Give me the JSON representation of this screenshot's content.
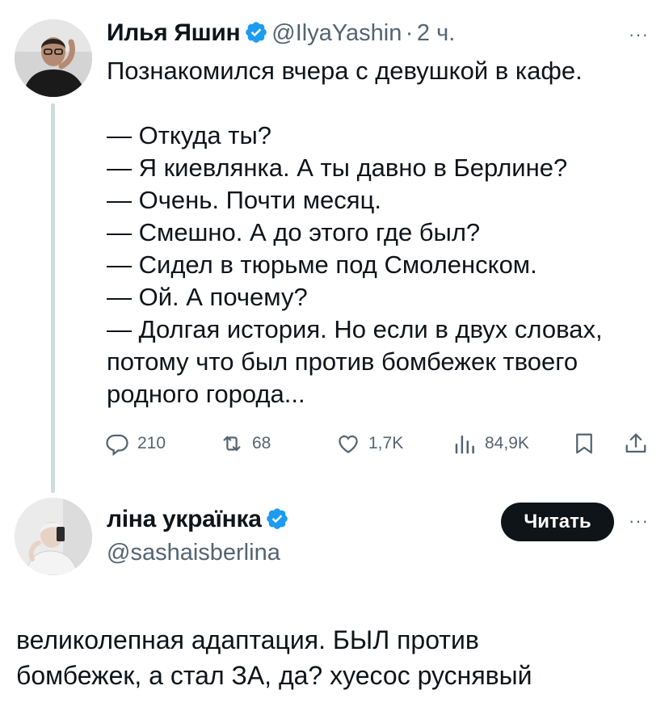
{
  "tweet": {
    "author_name": "Илья Яшин",
    "handle": "@IlyaYashin",
    "separator": "·",
    "time": "2 ч.",
    "more": "···",
    "lines": [
      "Познакомился вчера с девушкой в кафе.",
      "",
      "— Откуда ты?",
      "— Я киевлянка. А ты давно в Берлине?",
      "— Очень. Почти месяц.",
      "— Смешно. А до этого где был?",
      "— Сидел в тюрьме под Смоленском.",
      "— Ой. А почему?",
      "— Долгая история. Но если в двух словах,",
      "потому что был против бомбежек твоего",
      "родного города..."
    ],
    "stats": {
      "replies": "210",
      "reposts": "68",
      "likes": "1,7K",
      "views": "84,9K"
    }
  },
  "reply": {
    "author_name": "ліна українка",
    "handle": "@sashaisberlina",
    "follow_label": "Читать",
    "more": "···",
    "lines": [
      "великолепная адаптация. БЫЛ против",
      "бомбежек, а стал ЗА, да? хуесос руснявый"
    ]
  },
  "colors": {
    "verified": "#1d9bf0",
    "secondary_text": "#536471",
    "primary_text": "#0f1419"
  }
}
